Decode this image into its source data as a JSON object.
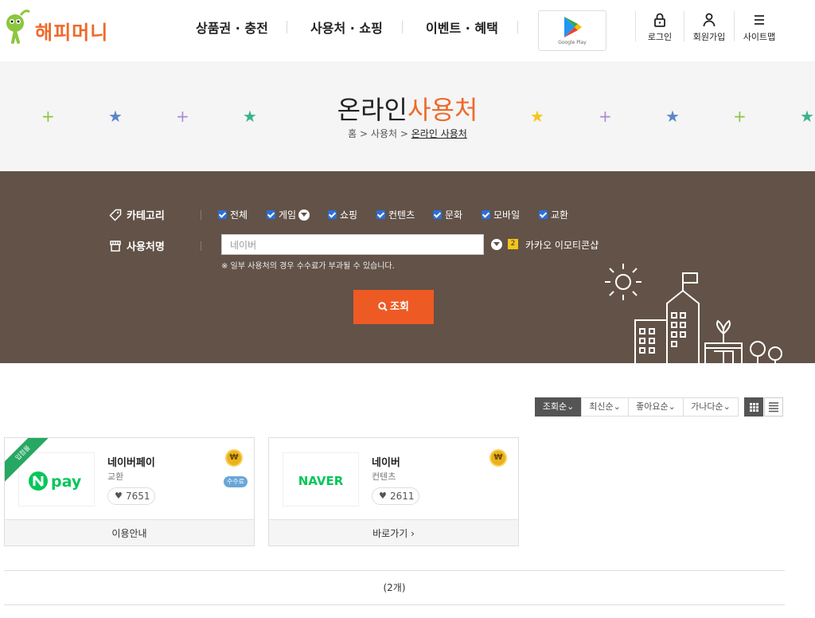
{
  "brand": {
    "name": "해피머니",
    "accent": "#ee6a2a"
  },
  "nav": {
    "items": [
      "상품권 · 충전",
      "사용처 · 쇼핑",
      "이벤트 · 혜택"
    ],
    "app_store_label": "Google Play",
    "util": [
      "로그인",
      "회원가입",
      "사이트맵"
    ]
  },
  "page": {
    "title_plain": "온라인",
    "title_accent": "사용처",
    "breadcrumb": [
      "홈",
      "사용처",
      "온라인 사용처"
    ]
  },
  "search": {
    "category_label": "카테고리",
    "categories": [
      "전체",
      "게임",
      "쇼핑",
      "컨텐츠",
      "문화",
      "모바일",
      "교환"
    ],
    "name_label": "사용처명",
    "name_value": "네이버",
    "rank_number": "2",
    "suggest": "카카오 이모티콘샵",
    "notice": "※ 일부 사용처의 경우 수수료가 부과될 수 있습니다.",
    "button": "조회"
  },
  "sort": {
    "options": [
      "조회순",
      "최신순",
      "좋아요순",
      "가나다순"
    ],
    "active": "조회순"
  },
  "cards": [
    {
      "ribbon": "입점몰",
      "logo": "N pay",
      "name": "네이버페이",
      "category": "교환",
      "likes": "7651",
      "coin": "₩",
      "fee": "수수료",
      "footer": "이용안내"
    },
    {
      "logo": "NAVER",
      "name": "네이버",
      "category": "컨텐츠",
      "likes": "2611",
      "coin": "₩",
      "footer": "바로가기 ›"
    }
  ],
  "result_count": "(2개)",
  "colors": {
    "panel": "#625247",
    "button": "#ee5a24",
    "naver_green": "#03c75a"
  }
}
